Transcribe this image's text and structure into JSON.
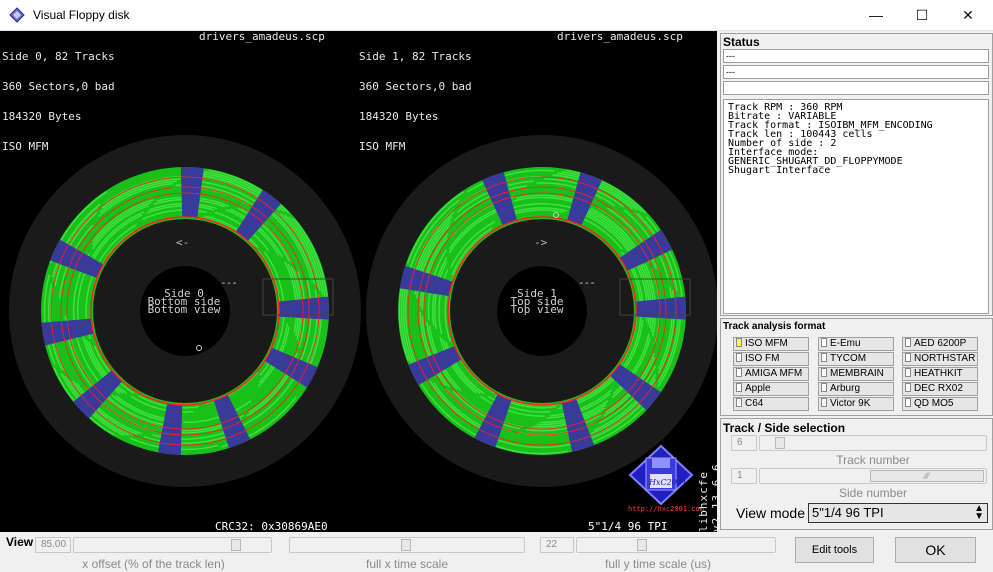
{
  "window": {
    "title": "Visual Floppy disk",
    "minimize": "—",
    "maximize": "☐",
    "close": "✕"
  },
  "disk": {
    "side0": {
      "info": [
        "Side 0, 82 Tracks",
        "360 Sectors,0 bad",
        "184320 Bytes",
        "ISO MFM"
      ],
      "filename": "drivers_amadeus.scp",
      "center": [
        "Side 0",
        "Bottom side",
        "Bottom view"
      ],
      "arrow": "<-"
    },
    "side1": {
      "info": [
        "Side 1, 82 Tracks",
        "360 Sectors,0 bad",
        "184320 Bytes",
        "ISO MFM"
      ],
      "filename": "drivers_amadeus.scp",
      "center": [
        "Side 1",
        "Top side",
        "Top view"
      ],
      "arrow": "->"
    },
    "dash": "---",
    "crc": "CRC32: 0x30869AE0",
    "tpi": "5\"1/4 96 TPI",
    "lib_version": "libhxcfe v2.13.6.6",
    "logo_text": "HxC2001",
    "logo_url": "http://hxc2001.com",
    "colors": {
      "good_sector": "#19c019",
      "good_sector_light": "#40e040",
      "track_gap": "#000000",
      "index_band": "#3a3a9a",
      "red_mark": "#ff2020",
      "disk_bg": "#1a1a1a"
    }
  },
  "status": {
    "title": "Status",
    "lines": [
      "---",
      "---",
      ""
    ],
    "track_info": [
      "Track RPM : 360 RPM",
      "",
      "Bitrate : VARIABLE",
      "",
      "Track format : ISOIBM_MFM_ENCODING",
      "",
      "Track len : 100443 cells",
      "Number of side : 2",
      "",
      "Interface mode:",
      "GENERIC_SHUGART_DD_FLOPPYMODE",
      "Shugart Interface"
    ]
  },
  "analysis": {
    "title": "Track analysis format",
    "formats": [
      {
        "label": "ISO MFM",
        "checked": true
      },
      {
        "label": "E-Emu",
        "checked": false
      },
      {
        "label": "AED 6200P",
        "checked": false
      },
      {
        "label": "ISO FM",
        "checked": false
      },
      {
        "label": "TYCOM",
        "checked": false
      },
      {
        "label": "NORTHSTAR",
        "checked": false
      },
      {
        "label": "AMIGA MFM",
        "checked": false
      },
      {
        "label": "MEMBRAIN",
        "checked": false
      },
      {
        "label": "HEATHKIT",
        "checked": false
      },
      {
        "label": "Apple",
        "checked": false
      },
      {
        "label": "Arburg",
        "checked": false
      },
      {
        "label": "DEC RX02",
        "checked": false
      },
      {
        "label": "C64",
        "checked": false
      },
      {
        "label": "Victor 9K",
        "checked": false
      },
      {
        "label": "QD MO5",
        "checked": false
      }
    ]
  },
  "track_side": {
    "title": "Track / Side selection",
    "track_value": "6",
    "track_caption": "Track number",
    "track_fraction": 0.07,
    "side_value": "1",
    "side_caption": "Side number",
    "side_fraction": 1.0,
    "view_mode_label": "View mode",
    "view_mode_value": "5\"1/4 96 TPI"
  },
  "view": {
    "title": "View",
    "x_offset_value": "85.00",
    "x_offset_caption": "x offset (% of the track len)",
    "x_offset_fraction": 0.85,
    "x_time_caption": "full x time scale",
    "x_time_fraction": 0.5,
    "y_time_value": "22",
    "y_time_caption": "full y time scale (us)",
    "y_time_fraction": 0.32,
    "edit_tools": "Edit tools",
    "ok": "OK"
  }
}
